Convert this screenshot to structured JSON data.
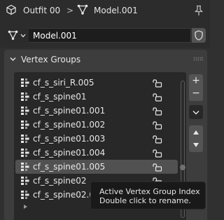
{
  "breadcrumb": {
    "object_name": "Outfit 00",
    "separator": ">",
    "mesh_name": "Model.001"
  },
  "datablock": {
    "name": "Model.001"
  },
  "panel": {
    "title": "Vertex Groups",
    "items": [
      {
        "label": "cf_s_siri_R.005",
        "locked": false,
        "active": false
      },
      {
        "label": "cf_s_spine01",
        "locked": false,
        "active": false
      },
      {
        "label": "cf_s_spine01.001",
        "locked": false,
        "active": false
      },
      {
        "label": "cf_s_spine01.002",
        "locked": false,
        "active": false
      },
      {
        "label": "cf_s_spine01.003",
        "locked": false,
        "active": false
      },
      {
        "label": "cf_s_spine01.004",
        "locked": false,
        "active": false
      },
      {
        "label": "cf_s_spine01.005",
        "locked": false,
        "active": true
      },
      {
        "label": "cf_s_spine02",
        "locked": false,
        "active": false
      },
      {
        "label": "cf_s_spine02.00",
        "locked": false,
        "active": false
      }
    ],
    "buttons": {
      "add": "+",
      "remove": "−"
    }
  },
  "tooltip": {
    "line1": "Active Vertex Group Index",
    "line2": "Double click to rename."
  },
  "colors": {
    "background": "#303030",
    "panel": "#3d3d3d",
    "list": "#282828",
    "active_row": "#515151",
    "tooltip_bg": "#191919",
    "text": "#e6e6e6"
  }
}
